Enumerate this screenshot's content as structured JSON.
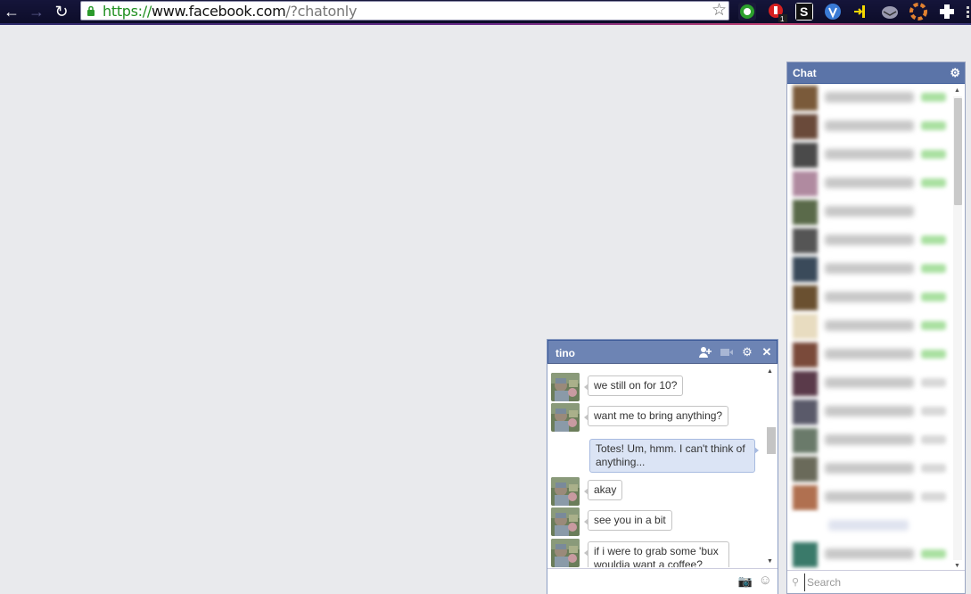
{
  "browser": {
    "url_scheme": "https://",
    "url_host": "www.facebook.com",
    "url_path": "/?chatonly",
    "icons": [
      "back-icon",
      "forward-icon",
      "reload-icon",
      "lock-icon",
      "bookmark-star-icon"
    ],
    "extension_badge": "1"
  },
  "sidebar": {
    "title": "Chat",
    "search_placeholder": "Search",
    "friends_count_visible": 17
  },
  "chat": {
    "title": "tino",
    "messages": [
      {
        "direction": "in",
        "text": "we still on for 10?"
      },
      {
        "direction": "in",
        "text": "want me to bring anything?"
      },
      {
        "direction": "out",
        "text": "Totes! Um, hmm. I can't think of anything..."
      },
      {
        "direction": "in",
        "text": "akay"
      },
      {
        "direction": "in",
        "text": "see you in a bit"
      },
      {
        "direction": "in",
        "text": "if i were to grab some 'bux wouldja want a coffee?"
      }
    ]
  },
  "colors": {
    "chat_header": "#6d84b4",
    "sidebar_header": "#5b74a8",
    "page_bg": "#e9eaed",
    "outgoing_bubble": "#dbe4f5"
  }
}
